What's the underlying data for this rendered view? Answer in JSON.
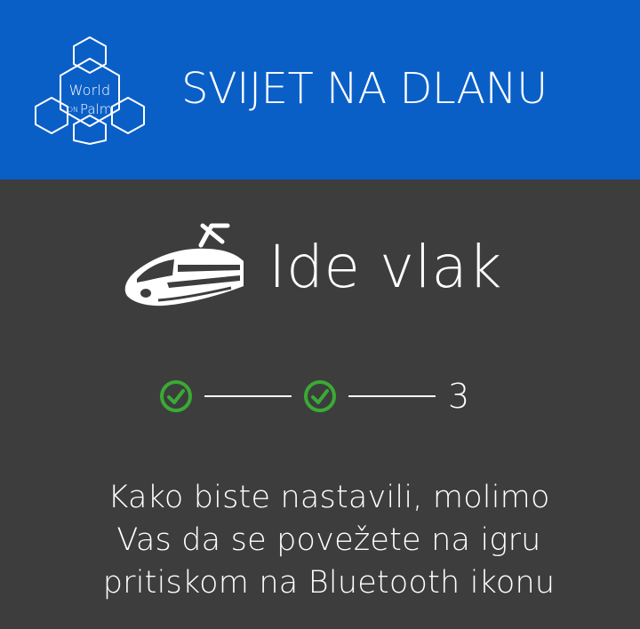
{
  "header": {
    "logo": {
      "word_top": "World",
      "word_on": "ON",
      "word_bottom": "Palm"
    },
    "title": "SVIJET NA DLANU",
    "background_color": "#0a5fc7"
  },
  "game": {
    "icon": "train-icon",
    "title": "Ide vlak"
  },
  "progress": {
    "steps": [
      {
        "state": "completed",
        "icon": "check-circle-icon"
      },
      {
        "state": "completed",
        "icon": "check-circle-icon"
      },
      {
        "state": "current",
        "label": "3"
      }
    ],
    "completed_color": "#3aaa35"
  },
  "message": {
    "lines": [
      "Kako biste nastavili, molimo",
      "Vas da se povežete na igru",
      "pritiskom na Bluetooth ikonu"
    ]
  },
  "colors": {
    "body_background": "#3d3d3d",
    "text": "#ffffff"
  }
}
